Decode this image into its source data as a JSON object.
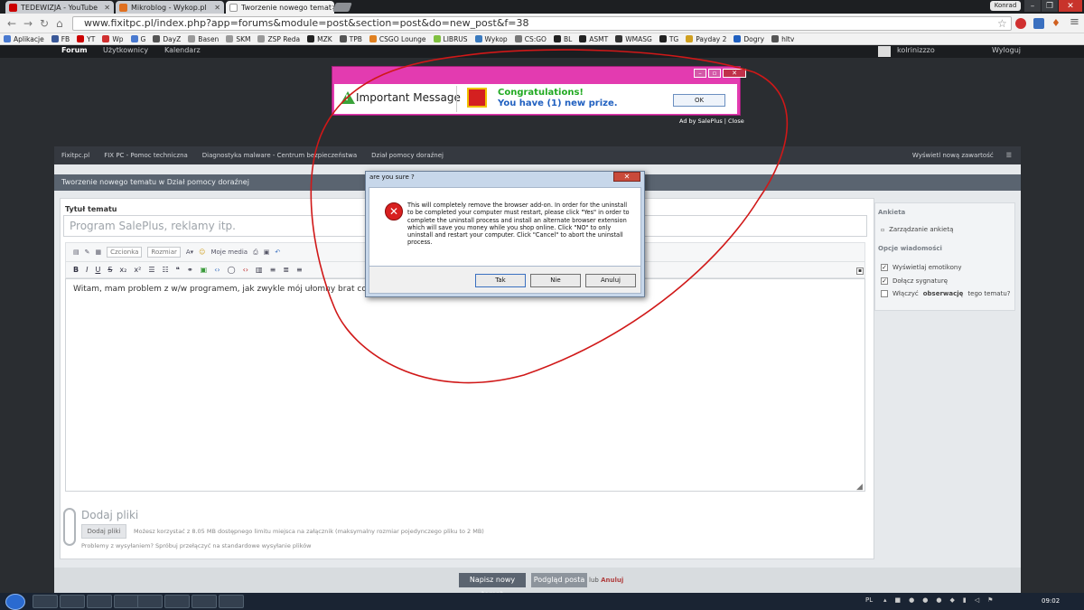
{
  "browser": {
    "tabs": [
      {
        "label": "TEDEWIZJA - YouTube",
        "color": "#cc0000"
      },
      {
        "label": "Mikroblog - Wykop.pl",
        "color": "#e07020"
      },
      {
        "label": "Tworzenie nowego temat",
        "color": "#888888"
      }
    ],
    "profile": "Konrad",
    "url": "www.fixitpc.pl/index.php?app=forums&module=post&section=post&do=new_post&f=38",
    "bookmarks": [
      {
        "label": "Aplikacje",
        "color": "#4a7ad0"
      },
      {
        "label": "FB",
        "color": "#3b5998"
      },
      {
        "label": "YT",
        "color": "#cc0000"
      },
      {
        "label": "Wp",
        "color": "#d03030"
      },
      {
        "label": "G",
        "color": "#4a7ad0"
      },
      {
        "label": "DayZ",
        "color": "#555555"
      },
      {
        "label": "Basen",
        "color": "#999999"
      },
      {
        "label": "SKM",
        "color": "#999999"
      },
      {
        "label": "ZSP Reda",
        "color": "#999999"
      },
      {
        "label": "MZK",
        "color": "#222222"
      },
      {
        "label": "TPB",
        "color": "#555555"
      },
      {
        "label": "CSGO Lounge",
        "color": "#e08020"
      },
      {
        "label": "LIBRUS",
        "color": "#80c040"
      },
      {
        "label": "Wykop",
        "color": "#3b7bbf"
      },
      {
        "label": "CS:GO",
        "color": "#777777"
      },
      {
        "label": "BL",
        "color": "#222222"
      },
      {
        "label": "ASMT",
        "color": "#222222"
      },
      {
        "label": "WMASG",
        "color": "#333333"
      },
      {
        "label": "TG",
        "color": "#222222"
      },
      {
        "label": "Payday 2",
        "color": "#d0a020"
      },
      {
        "label": "Dogry",
        "color": "#2060c0"
      },
      {
        "label": "hltv",
        "color": "#555555"
      }
    ]
  },
  "site": {
    "top_nav": [
      "Forum",
      "Użytkownicy",
      "Kalendarz"
    ],
    "user": "kolrinizzzo",
    "logout": "Wyloguj",
    "breadcrumb": [
      "Fixitpc.pl",
      "FIX PC - Pomoc techniczna",
      "Diagnostyka malware - Centrum bezpieczeństwa",
      "Dział pomocy doraźnej"
    ],
    "new_content": "Wyświetl nową zawartość"
  },
  "form": {
    "heading": "Tworzenie nowego tematu w Dział pomocy doraźnej",
    "title_label": "Tytuł tematu",
    "title_value": "Program SalePlus, reklamy itp.",
    "font_select": "Czcionka",
    "size_select": "Rozmiar",
    "my_media": "Moje media",
    "body_text": "Witam, mam problem z w/w programem, jak zwykle mój ułomny brat coś pobrał, te",
    "add_files_title": "Dodaj pliki",
    "add_files_button": "Dodaj pliki",
    "quota_text": "Możesz korzystać z 8.05 MB dostępnego limitu miejsca na załącznik (maksymalny rozmiar pojedynczego pliku to 2 MB)",
    "problems_text": "Problemy z wysyłaniem? Spróbuj przełączyć na standardowe wysyłanie plików",
    "submit": "Napisz nowy temat",
    "preview": "Podgląd posta",
    "or": "lub",
    "cancel": "Anuluj"
  },
  "sidebar": {
    "poll_header": "Ankieta",
    "poll_manage": "Zarządzanie ankietą",
    "options_header": "Opcje wiadomości",
    "opt_emoticons": "Wyświetlaj emotikony",
    "opt_signature": "Dołącz sygnaturę",
    "opt_watch_prefix": "Włączyć",
    "opt_watch_bold": "obserwację",
    "opt_watch_suffix": "tego tematu?"
  },
  "ad": {
    "important": "Important Message",
    "congrats": "Congratulations!",
    "prize": "You have (1) new prize.",
    "ok": "OK",
    "ad_by": "Ad by SalePlus | Close"
  },
  "dialog": {
    "title": "are you sure ?",
    "message": "This will completely remove the browser add-on. In order for the uninstall to be completed your computer must restart, please click \"Yes\" in order to complete the uninstall process and install an alternate browser extension which will save you money while you shop online. Click \"NO\" to only uninstall and restart your computer. Click \"Cancel\" to abort the uninstall process.",
    "yes": "Tak",
    "no": "Nie",
    "cancel": "Anuluj"
  },
  "taskbar": {
    "language": "PL",
    "clock": "09:02"
  }
}
